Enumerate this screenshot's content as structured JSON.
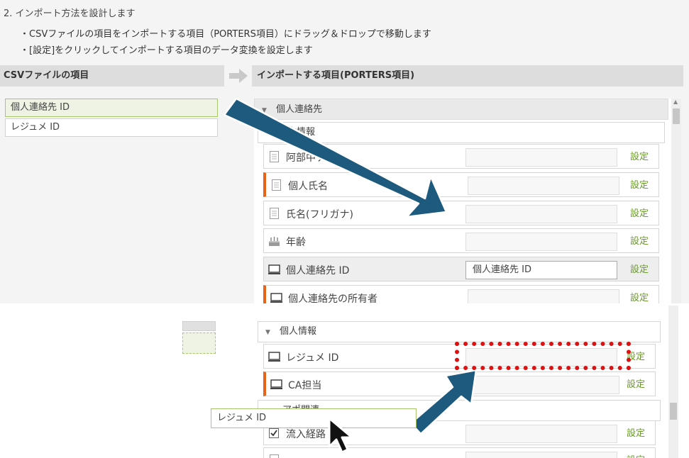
{
  "step_title": "2. インポート方法を設計します",
  "instructions": [
    "・CSVファイルの項目をインポートする項目（PORTERS項目）にドラッグ＆ドロップで移動します",
    "・[設定]をクリックしてインポートする項目のデータ変換を設定します"
  ],
  "csv_column": {
    "header": "CSVファイルの項目",
    "items": [
      "個人連絡先 ID",
      "レジュメ ID"
    ]
  },
  "import_column": {
    "header": "インポートする項目(PORTERS項目)",
    "group": "個人連絡先",
    "subgroup": "基本情報",
    "fields": [
      {
        "label": "阿部中テスト",
        "icon": "document-icon",
        "value": ""
      },
      {
        "label": "個人氏名",
        "icon": "document-icon",
        "value": ""
      },
      {
        "label": "氏名(フリガナ)",
        "icon": "document-icon",
        "value": ""
      },
      {
        "label": "年齢",
        "icon": "birthday-cake-icon",
        "value": ""
      },
      {
        "label": "個人連絡先 ID",
        "icon": "monitor-icon",
        "value": "個人連絡先 ID"
      },
      {
        "label": "個人連絡先の所有者",
        "icon": "monitor-icon",
        "value": ""
      }
    ]
  },
  "lower": {
    "subgroup": "個人情報",
    "fields": [
      {
        "label": "レジュメ ID",
        "icon": "monitor-icon",
        "value": ""
      },
      {
        "label": "CA担当",
        "icon": "monitor-icon",
        "value": ""
      }
    ],
    "subgroup2": "アポ関連",
    "fields2": [
      {
        "label": "流入経路",
        "icon": "checkbox-icon",
        "value": ""
      },
      {
        "label": "",
        "icon": "document-icon",
        "value": ""
      }
    ],
    "drag_ghost": "レジュメ ID"
  },
  "set_label": "設定",
  "colors": {
    "accent_green": "#6a9a2a",
    "required_orange": "#e8631a",
    "arrow_blue": "#1d5a7e",
    "drop_red": "#dd1111"
  }
}
